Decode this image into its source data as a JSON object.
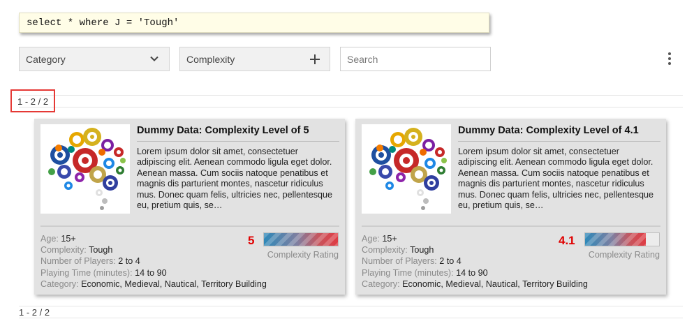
{
  "query": {
    "text": "select * where J = 'Tough'"
  },
  "filters": {
    "category_label": "Category",
    "complexity_label": "Complexity",
    "search_placeholder": "Search"
  },
  "pagination": {
    "top": "1 - 2 / 2",
    "bottom": "1 - 2 / 2"
  },
  "labels": {
    "age": "Age:",
    "complexity": "Complexity:",
    "players": "Number of Players:",
    "playing_time": "Playing Time (minutes):",
    "category": "Category:",
    "rating_caption": "Complexity Rating"
  },
  "cards": [
    {
      "title": "Dummy Data: Complexity Level of 5",
      "description": "Lorem ipsum dolor sit amet, consectetuer adipiscing elit. Aenean commodo ligula eget dolor. Aenean massa. Cum sociis natoque penatibus et magnis dis parturient montes, nascetur ridiculus mus. Donec quam felis, ultricies nec, pellentesque eu, pretium quis, se…",
      "age": "15+",
      "complexity": "Tough",
      "players": "2 to 4",
      "playing_time": "14 to 90",
      "category": "Economic, Medieval, Nautical, Territory Building",
      "rating": "5",
      "rating_fraction": 1.0
    },
    {
      "title": "Dummy Data: Complexity Level of 4.1",
      "description": "Lorem ipsum dolor sit amet, consectetuer adipiscing elit. Aenean commodo ligula eget dolor. Aenean massa. Cum sociis natoque penatibus et magnis dis parturient montes, nascetur ridiculus mus. Donec quam felis, ultricies nec, pellentesque eu, pretium quis, se…",
      "age": "15+",
      "complexity": "Tough",
      "players": "2 to 4",
      "playing_time": "14 to 90",
      "category": "Economic, Medieval, Nautical, Territory Building",
      "rating": "4.1",
      "rating_fraction": 0.82
    }
  ],
  "colors": {
    "rating_red": "#e00000",
    "highlight_red": "#e53935",
    "query_bg": "#fffde7"
  },
  "icons": {
    "category_dropdown": "chevron-down-icon",
    "complexity_add": "plus-icon",
    "menu": "more-vert-icon",
    "card_image": "gears-brain-icon"
  }
}
